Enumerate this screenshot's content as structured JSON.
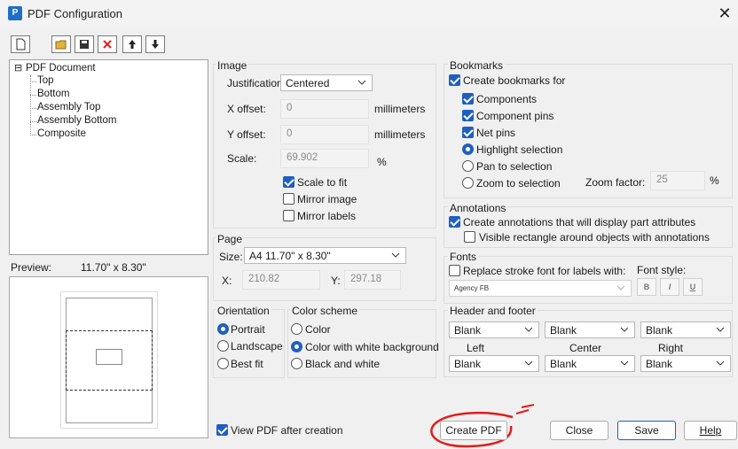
{
  "window": {
    "title": "PDF Configuration",
    "app_icon": "pdf-app-icon",
    "close_icon": "close-icon"
  },
  "toolbar": {
    "buttons": [
      {
        "name": "new-page-button",
        "icon": "new-page-icon"
      },
      {
        "name": "open-folder-button",
        "icon": "open-folder-icon"
      },
      {
        "name": "save-button",
        "icon": "save-icon"
      },
      {
        "name": "delete-button",
        "icon": "delete-icon"
      },
      {
        "name": "move-up-button",
        "icon": "arrow-up-icon"
      },
      {
        "name": "move-down-button",
        "icon": "arrow-down-icon"
      }
    ]
  },
  "tree": {
    "root": "PDF Document",
    "expand_glyph": "⊟",
    "children": [
      "Top",
      "Bottom",
      "Assembly Top",
      "Assembly Bottom",
      "Composite"
    ]
  },
  "preview": {
    "label": "Preview:",
    "size": "11.70\" x  8.30\""
  },
  "image": {
    "title": "Image",
    "justification_label": "Justification:",
    "justification_value": "Centered",
    "x_offset_label": "X offset:",
    "x_offset_value": "0",
    "x_offset_unit": "millimeters",
    "y_offset_label": "Y offset:",
    "y_offset_value": "0",
    "y_offset_unit": "millimeters",
    "scale_label": "Scale:",
    "scale_value": "69.902",
    "scale_unit": "%",
    "scale_to_fit": "Scale to fit",
    "mirror_image": "Mirror image",
    "mirror_labels": "Mirror labels"
  },
  "page": {
    "title": "Page",
    "size_label": "Size:",
    "size_value": "A4   11.70\" x  8.30\"",
    "x_label": "X:",
    "x_value": "210.82",
    "y_label": "Y:",
    "y_value": "297.18"
  },
  "orientation": {
    "title": "Orientation",
    "options": [
      "Portrait",
      "Landscape",
      "Best fit"
    ],
    "selected": "Portrait"
  },
  "color_scheme": {
    "title": "Color scheme",
    "options": [
      "Color",
      "Color with white background",
      "Black and white"
    ],
    "selected": "Color with white background"
  },
  "bookmarks": {
    "title": "Bookmarks",
    "create_for": "Create bookmarks for",
    "components": "Components",
    "component_pins": "Component pins",
    "net_pins": "Net pins",
    "highlight": "Highlight selection",
    "pan": "Pan to selection",
    "zoom": "Zoom to selection",
    "zoom_factor_label": "Zoom factor:",
    "zoom_factor_value": "25",
    "zoom_factor_unit": "%"
  },
  "annotations": {
    "title": "Annotations",
    "create": "Create annotations that will display part attributes",
    "visible_rect": "Visible rectangle around objects with annotations"
  },
  "fonts": {
    "title": "Fonts",
    "replace": "Replace stroke font for labels with:",
    "font_value": "Agency FB",
    "style_label": "Font style:",
    "bold": "B",
    "italic": "I",
    "underline": "U"
  },
  "header_footer": {
    "title": "Header and footer",
    "top_row": [
      "Blank",
      "Blank",
      "Blank"
    ],
    "labels": [
      "Left",
      "Center",
      "Right"
    ],
    "bottom_row": [
      "Blank",
      "Blank",
      "Blank"
    ]
  },
  "footer": {
    "view_pdf": "View PDF after creation",
    "create_pdf": "Create PDF",
    "close": "Close",
    "save": "Save",
    "help": "Help"
  }
}
